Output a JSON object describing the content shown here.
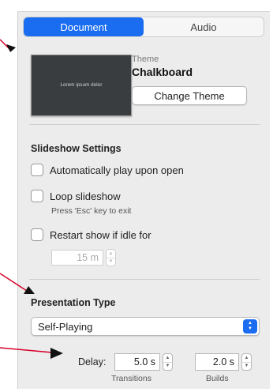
{
  "tabs": [
    {
      "label": "Document",
      "active": true
    },
    {
      "label": "Audio",
      "active": false
    }
  ],
  "theme": {
    "thumbnail_text": "Lorem ipsum dolor",
    "label": "Theme",
    "name": "Chalkboard",
    "change_button": "Change Theme"
  },
  "slideshow": {
    "title": "Slideshow Settings",
    "auto_play": {
      "label": "Automatically play upon open",
      "checked": false
    },
    "loop": {
      "label": "Loop slideshow",
      "checked": false,
      "hint": "Press 'Esc' key to exit"
    },
    "restart": {
      "label": "Restart show if idle for",
      "checked": false,
      "idle_value": "15 m"
    }
  },
  "presentation": {
    "title": "Presentation Type",
    "selected": "Self-Playing",
    "delay_label": "Delay:",
    "transitions_value": "5.0 s",
    "builds_value": "2.0 s",
    "transitions_caption": "Transitions",
    "builds_caption": "Builds"
  },
  "colors": {
    "accent": "#1a6df0",
    "annotation_arrow": "#d6002a"
  },
  "icons": {
    "select_arrows": "updown-chevron-icon",
    "stepper_up": "chevron-up-icon",
    "stepper_down": "chevron-down-icon"
  }
}
